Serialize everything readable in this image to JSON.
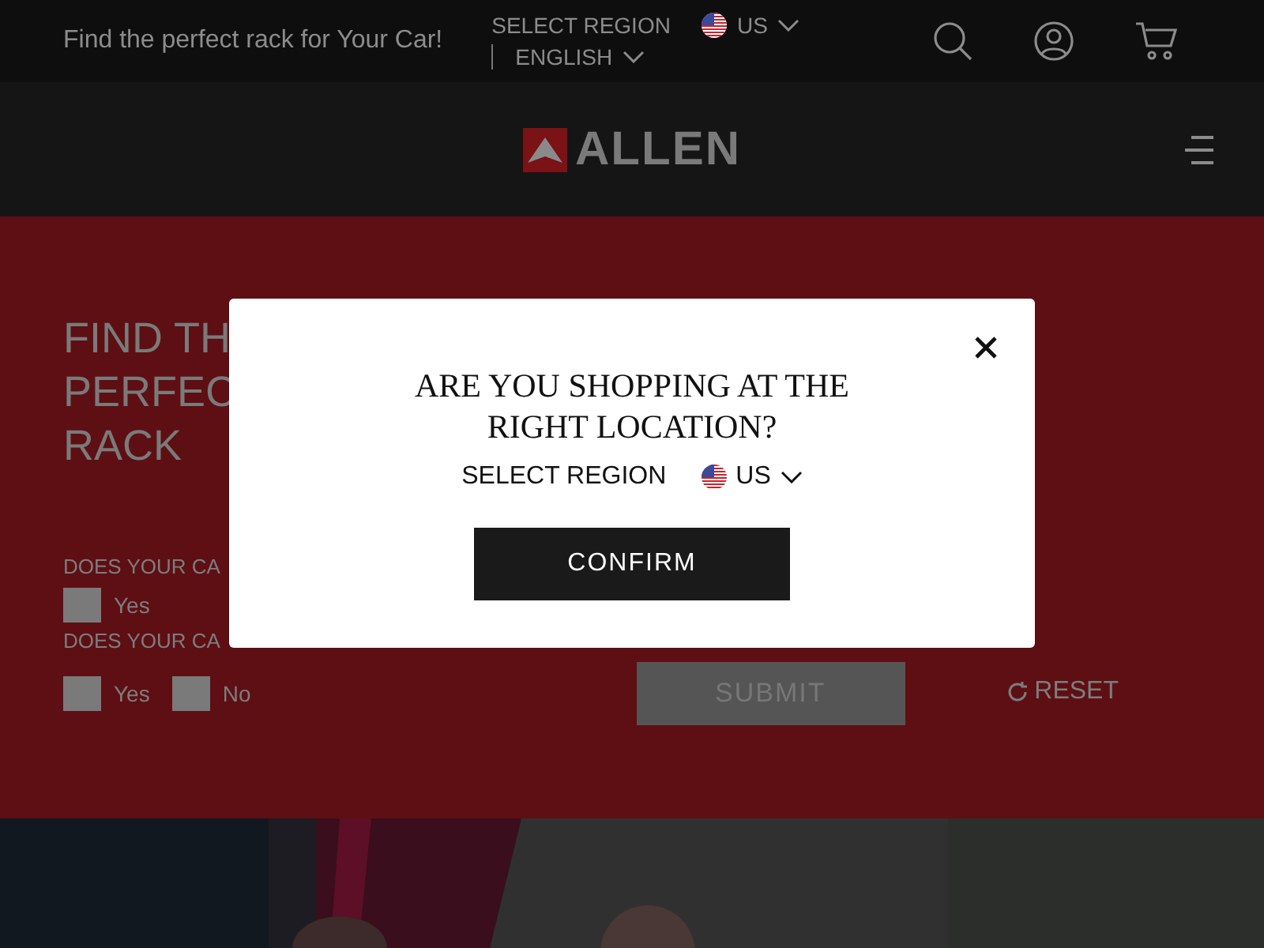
{
  "top_bar": {
    "tagline": "Find the perfect rack for Your Car!",
    "region_label": "SELECT REGION",
    "region": "US",
    "language": "ENGLISH"
  },
  "header": {
    "logo_text": "ALLEN"
  },
  "finder": {
    "heading_lines": [
      "FIND TH",
      "PERFEC",
      "RACK"
    ],
    "questions": [
      {
        "label": "DOES YOUR CA",
        "options": [
          {
            "label": "Yes",
            "checked": false
          }
        ]
      },
      {
        "label": "DOES YOUR CA",
        "options": [
          {
            "label": "Yes",
            "checked": false
          },
          {
            "label": "No",
            "checked": false
          }
        ]
      }
    ],
    "submit": {
      "label": "SUBMIT",
      "disabled": true
    },
    "reset": {
      "label": "RESET"
    }
  },
  "modal": {
    "title": "ARE YOU SHOPPING AT THE RIGHT LOCATION?",
    "region_label": "SELECT REGION",
    "region": "US",
    "confirm": "CONFIRM"
  }
}
